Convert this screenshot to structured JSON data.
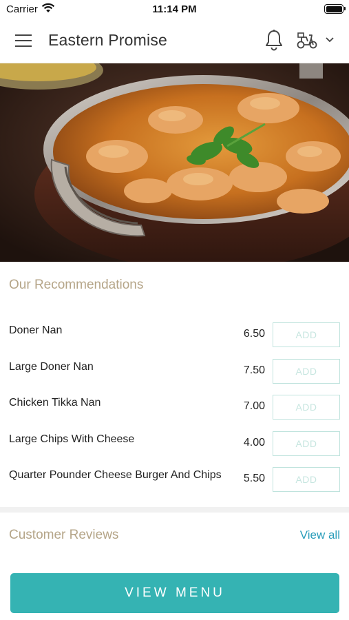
{
  "status_bar": {
    "carrier": "Carrier",
    "time": "11:14 PM"
  },
  "header": {
    "title": "Eastern Promise",
    "icons": [
      "menu-icon",
      "bell-icon",
      "scooter-icon",
      "chevron-down-icon"
    ]
  },
  "hero": {
    "description_icon": "curry-dish-image"
  },
  "recommendations": {
    "title": "Our Recommendations",
    "add_label": "ADD",
    "items": [
      {
        "name": "Doner Nan",
        "price": "6.50"
      },
      {
        "name": "Large Doner Nan",
        "price": "7.50"
      },
      {
        "name": "Chicken Tikka Nan",
        "price": "7.00"
      },
      {
        "name": "Large Chips With Cheese",
        "price": "4.00"
      },
      {
        "name": "Quarter Pounder Cheese Burger And Chips",
        "price": "5.50"
      }
    ]
  },
  "reviews": {
    "title": "Customer Reviews",
    "view_all": "View all"
  },
  "footer": {
    "view_menu": "VIEW MENU"
  },
  "colors": {
    "accent": "#35b3b3",
    "section_title": "#b5a588",
    "link": "#2a9dba",
    "add_border": "#bfe3dd"
  }
}
